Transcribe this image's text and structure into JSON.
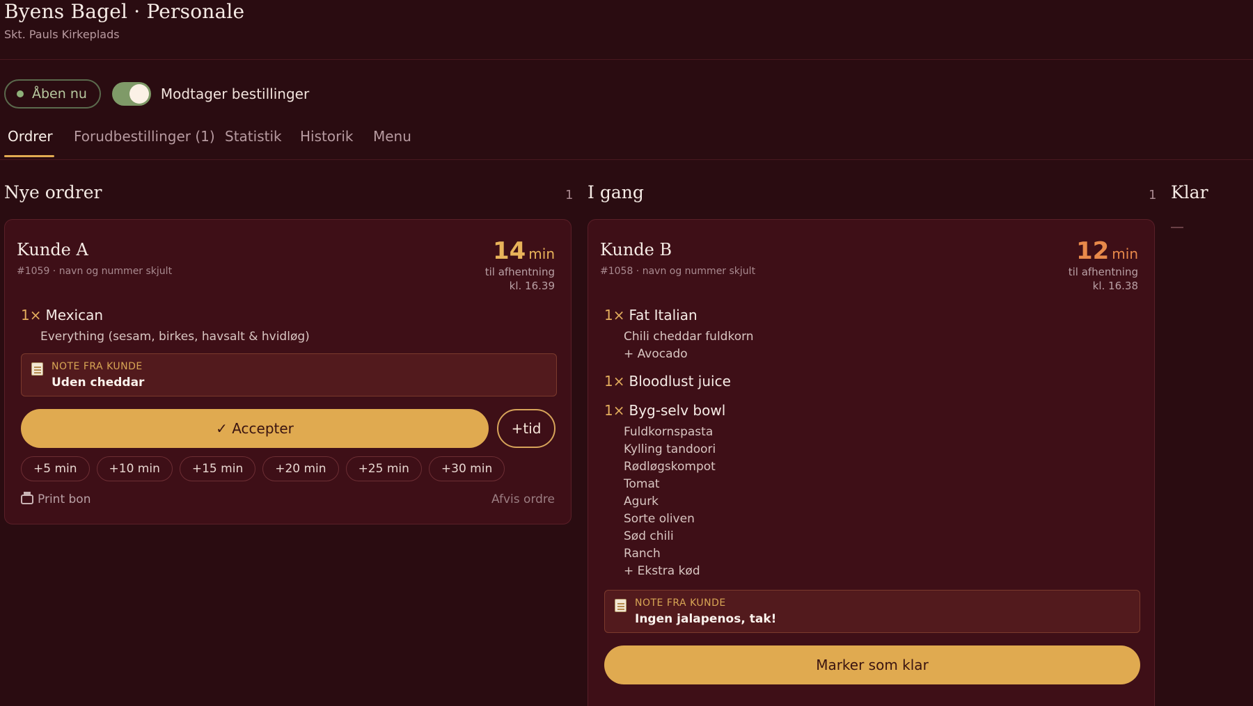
{
  "header": {
    "title": "Byens Bagel · Personale",
    "subtitle": "Skt. Pauls Kirkeplads"
  },
  "status": {
    "open_label": "Åben nu",
    "toggle_label": "Modtager bestillinger",
    "toggle_on": true
  },
  "tabs": [
    {
      "label": "Ordrer"
    },
    {
      "label": "Forudbestillinger (1)"
    },
    {
      "label": "Statistik"
    },
    {
      "label": "Historik"
    },
    {
      "label": "Menu"
    }
  ],
  "columns": {
    "new": {
      "title": "Nye ordrer",
      "count": "1"
    },
    "progress": {
      "title": "I gang",
      "count": "1"
    },
    "ready": {
      "title": "Klar",
      "empty": "—"
    }
  },
  "order_a": {
    "customer": "Kunde A",
    "meta": "#1059 · navn og nummer skjult",
    "time_value": "14",
    "time_unit": "min",
    "time_sub": "til afhentning",
    "time_clock": "kl. 16.39",
    "qty": "1×",
    "item": "Mexican",
    "modifier": "Everything (sesam, birkes, havsalt & hvidløg)",
    "note_label": "NOTE FRA KUNDE",
    "note_text": "Uden cheddar",
    "accept_label": "✓ Accepter",
    "add_time_label": "+tid",
    "time_chips": [
      "+5 min",
      "+10 min",
      "+15 min",
      "+20 min",
      "+25 min",
      "+30 min"
    ],
    "print_label": "Print bon",
    "reject_label": "Afvis ordre"
  },
  "order_b": {
    "customer": "Kunde B",
    "meta": "#1058 · navn og nummer skjult",
    "time_value": "12",
    "time_unit": "min",
    "time_sub": "til afhentning",
    "time_clock": "kl. 16.38",
    "items": [
      {
        "qty": "1×",
        "name": "Fat Italian",
        "mods": [
          "Chili cheddar fuldkorn",
          "+ Avocado"
        ]
      },
      {
        "qty": "1×",
        "name": "Bloodlust juice",
        "mods": []
      },
      {
        "qty": "1×",
        "name": "Byg-selv bowl",
        "mods": [
          "Fuldkornspasta",
          "Kylling tandoori",
          "Rødløgskompot",
          "Tomat",
          "Agurk",
          "Sorte oliven",
          "Sød chili",
          "Ranch",
          "+ Ekstra kød"
        ]
      }
    ],
    "note_label": "NOTE FRA KUNDE",
    "note_text": "Ingen jalapenos, tak!",
    "ready_label": "Marker som klar"
  }
}
